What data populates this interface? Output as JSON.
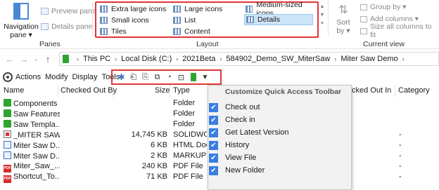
{
  "ribbon": {
    "panes": {
      "navigation_pane_label": "Navigation pane ▾",
      "preview_pane_label": "Preview pane",
      "details_pane_label": "Details pane",
      "group_label": "Panes"
    },
    "layout": {
      "extra_large_icons": "Extra large icons",
      "large_icons": "Large icons",
      "medium_icons": "Medium-sized icons",
      "small_icons": "Small icons",
      "list": "List",
      "details": "Details",
      "tiles": "Tiles",
      "content": "Content",
      "group_label": "Layout",
      "selected": "Details"
    },
    "current_view": {
      "sort_by_label": "Sort by ▾",
      "group_by_label": "Group by ▾",
      "add_columns_label": "Add columns ▾",
      "size_all_columns_label": "Size all columns to fit",
      "group_label": "Current view"
    }
  },
  "address": {
    "back": "←",
    "forward": "→",
    "recent": "⌄",
    "up": "↑",
    "crumbs": [
      "This PC",
      "Local Disk (C:)",
      "2021Beta",
      "584902_Demo_SW_MiterSaw",
      "Miter Saw Demo"
    ]
  },
  "toolbar": {
    "menus": [
      "Actions",
      "Modify",
      "Display",
      "Tools"
    ]
  },
  "columns": {
    "name": "Name",
    "checked_out_by": "Checked Out By",
    "size": "Size",
    "type": "Type",
    "checked_out_in": "cked Out In",
    "category": "Category"
  },
  "files": [
    {
      "name": "Components",
      "size": "",
      "type": "Folder",
      "category": "",
      "icon": "folder-icon"
    },
    {
      "name": "Saw Features",
      "size": "",
      "type": "Folder",
      "category": "",
      "icon": "folder-icon"
    },
    {
      "name": "Saw Templa...",
      "size": "",
      "type": "Folder",
      "category": "",
      "icon": "folder-icon"
    },
    {
      "name": "_MITER SAW",
      "size": "14,745 KB",
      "type": "SOLIDWOR",
      "category": "-",
      "icon": "solidworks-file-icon"
    },
    {
      "name": "Miter Saw D...",
      "size": "6 KB",
      "type": "HTML Doc",
      "category": "-",
      "icon": "html-file-icon"
    },
    {
      "name": "Miter Saw D...",
      "size": "2 KB",
      "type": "MARKUP F",
      "category": "-",
      "icon": "markup-file-icon"
    },
    {
      "name": "Miter_Saw_...",
      "size": "240 KB",
      "type": "PDF File",
      "category": "-",
      "icon": "pdf-file-icon"
    },
    {
      "name": "Shortcut_To...",
      "size": "71 KB",
      "type": "PDF File",
      "category": "-",
      "icon": "pdf-file-icon"
    }
  ],
  "qat_menu": {
    "title": "Customize Quick Access Toolbar",
    "items": [
      {
        "label": "Check out",
        "checked": true
      },
      {
        "label": "Check in",
        "checked": true
      },
      {
        "label": "Get Latest Version",
        "checked": true
      },
      {
        "label": "History",
        "checked": true
      },
      {
        "label": "View File",
        "checked": true
      },
      {
        "label": "New Folder",
        "checked": true
      }
    ]
  },
  "colors": {
    "highlight_border": "#e03636",
    "selection": "#cce4f7",
    "check_blue": "#3a7ee0",
    "pdm_green": "#2fa52f"
  }
}
